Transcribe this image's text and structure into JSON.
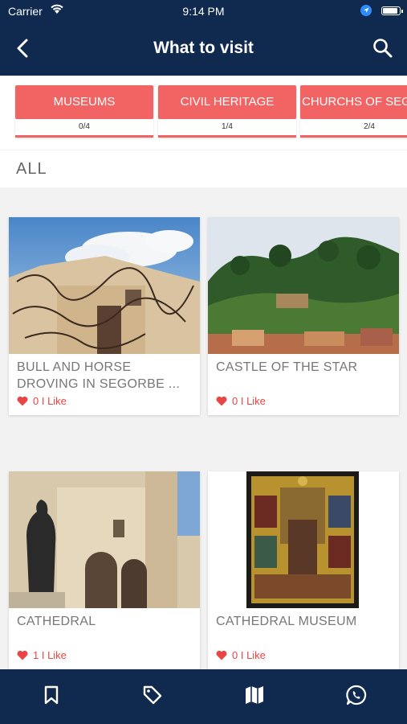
{
  "status": {
    "carrier": "Carrier",
    "time": "9:14 PM"
  },
  "header": {
    "title": "What to visit"
  },
  "categories": [
    {
      "label": "MUSEUMS",
      "count": "0/4"
    },
    {
      "label": "CIVIL HERITAGE",
      "count": "1/4"
    },
    {
      "label": "CHURCHS OF SEGORBE",
      "count": "2/4"
    }
  ],
  "section": {
    "label": "ALL"
  },
  "places": [
    {
      "name": "BULL AND HORSE DROVING IN SEGORBE ...",
      "likes": "0 I Like"
    },
    {
      "name": "CASTLE OF THE STAR",
      "likes": "0 I Like"
    },
    {
      "name": "CATHEDRAL",
      "likes": "1 I Like"
    },
    {
      "name": "CATHEDRAL MUSEUM",
      "likes": "0 I Like"
    }
  ],
  "tabbar": {
    "items": [
      "bookmark-icon",
      "tag-icon",
      "map-icon",
      "whatsapp-icon"
    ]
  },
  "colors": {
    "navy": "#10294f",
    "accent": "#f26363",
    "like": "#e84545"
  }
}
